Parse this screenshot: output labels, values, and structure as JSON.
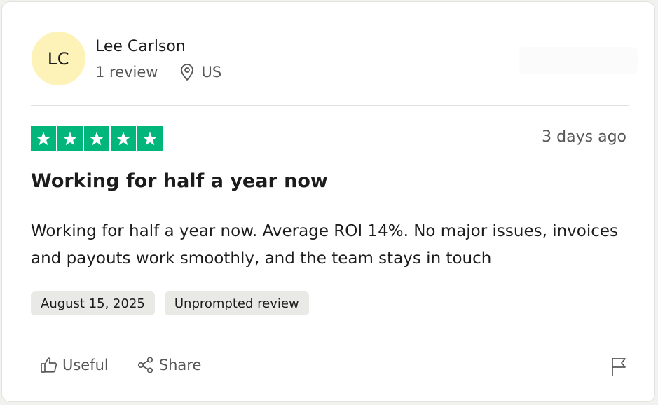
{
  "reviewer": {
    "initials": "LC",
    "name": "Lee Carlson",
    "review_count": "1 review",
    "country": "US"
  },
  "review": {
    "rating": 5,
    "posted_ago": "3 days ago",
    "title": "Working for half a year now",
    "body": "Working for half a year now. Average ROI 14%. No major issues, invoices and payouts work smoothly, and the team stays in touch",
    "date": "August 15, 2025",
    "tag": "Unprompted review"
  },
  "actions": {
    "useful_label": "Useful",
    "share_label": "Share"
  },
  "colors": {
    "star_green": "#00b67a",
    "avatar_bg": "#fdf3b8",
    "tag_bg": "#e9e9e6"
  },
  "icons": [
    "location-pin-icon",
    "star-icon",
    "thumbs-up-icon",
    "share-icon",
    "flag-icon"
  ]
}
